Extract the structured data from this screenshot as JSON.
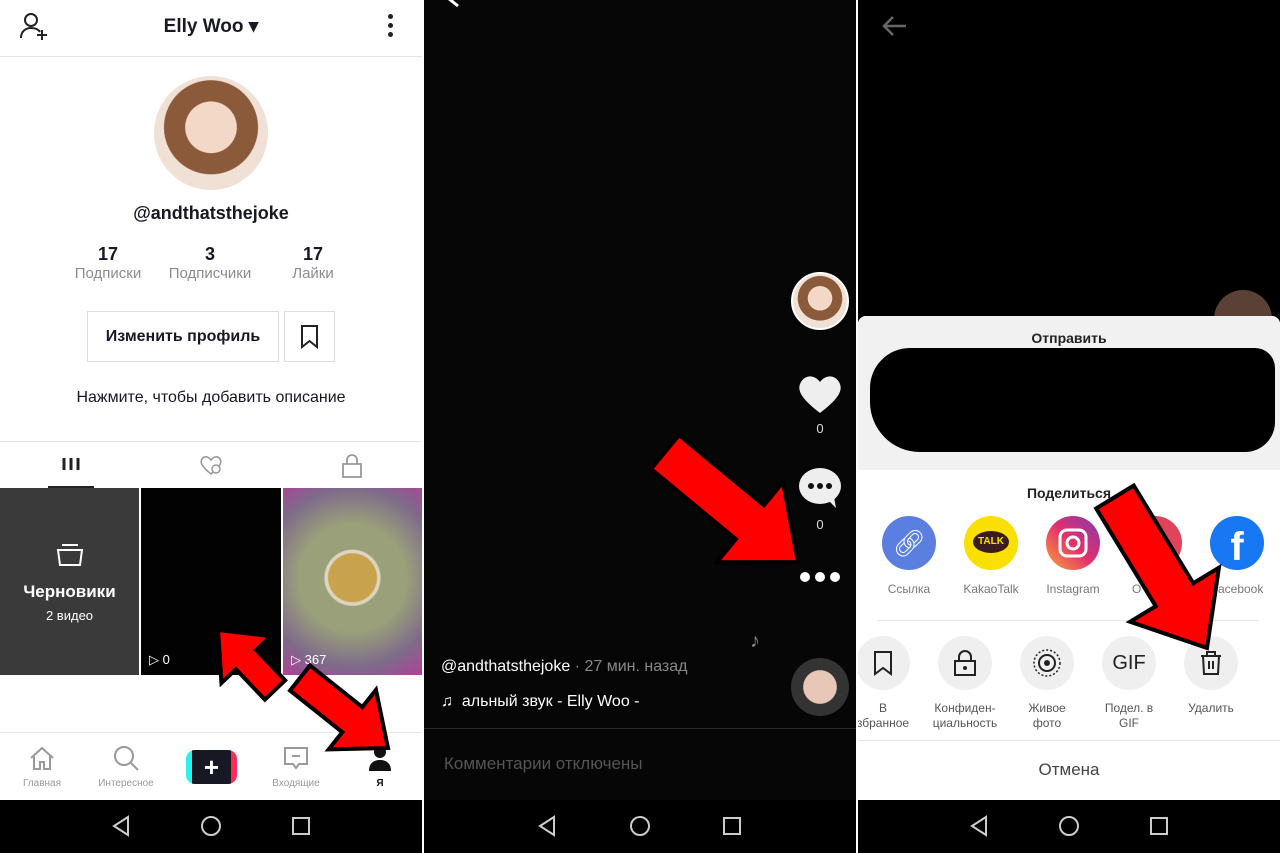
{
  "profile_screen": {
    "header": {
      "username": "Elly Woo",
      "add_user_icon": "person-plus-icon",
      "menu_icon": "vertical-dots-icon"
    },
    "handle": "@andthatsthejoke",
    "stats": [
      {
        "value": "17",
        "label": "Подписки"
      },
      {
        "value": "3",
        "label": "Подписчики"
      },
      {
        "value": "17",
        "label": "Лайки"
      }
    ],
    "edit_profile_label": "Изменить профиль",
    "description_prompt": "Нажмите, чтобы добавить описание",
    "tabs": [
      "grid-icon",
      "liked-hidden-icon",
      "lock-icon"
    ],
    "drafts": {
      "title": "Черновики",
      "count": "2 видео"
    },
    "videos": [
      {
        "views": "0"
      },
      {
        "views": "367"
      }
    ],
    "bottom_nav": [
      {
        "label": "Главная",
        "icon": "home-icon"
      },
      {
        "label": "Интересное",
        "icon": "search-icon"
      },
      {
        "label": "",
        "icon": "plus-icon"
      },
      {
        "label": "Входящие",
        "icon": "inbox-icon"
      },
      {
        "label": "Я",
        "icon": "person-icon"
      }
    ]
  },
  "video_screen": {
    "likes": "0",
    "comments": "0",
    "author": "@andthatsthejoke",
    "time": "· 27 мин. назад",
    "sound": "альный звук - Elly Woo -",
    "comments_disabled": "Комментарии отключены"
  },
  "share_sheet": {
    "send_title": "Отправить",
    "share_title": "Поделиться",
    "share_targets": [
      {
        "label": "Ссылка",
        "color": "#5b7fe0"
      },
      {
        "label": "KakaoTalk",
        "color": "#f9e000"
      },
      {
        "label": "Instagram",
        "color": "#d6287a"
      },
      {
        "label": "O",
        "color": "#e0445a"
      },
      {
        "label": "Facebook",
        "color": "#1877f2"
      }
    ],
    "kakao_badge": "TALK",
    "actions": [
      {
        "label": "В\nзбранное",
        "icon": "bookmark-icon"
      },
      {
        "label": "Конфиден-\nциальность",
        "icon": "lock-icon"
      },
      {
        "label": "Живое\nфото",
        "icon": "live-photo-icon"
      },
      {
        "label": "Подел. в\nGIF",
        "icon": "GIF"
      },
      {
        "label": "Удалить",
        "icon": "trash-icon"
      }
    ],
    "cancel_label": "Отмена"
  },
  "colors": {
    "accent_arrow": "#ff0000",
    "tiktok_cyan": "#25f4ee",
    "tiktok_red": "#fe2c55"
  }
}
